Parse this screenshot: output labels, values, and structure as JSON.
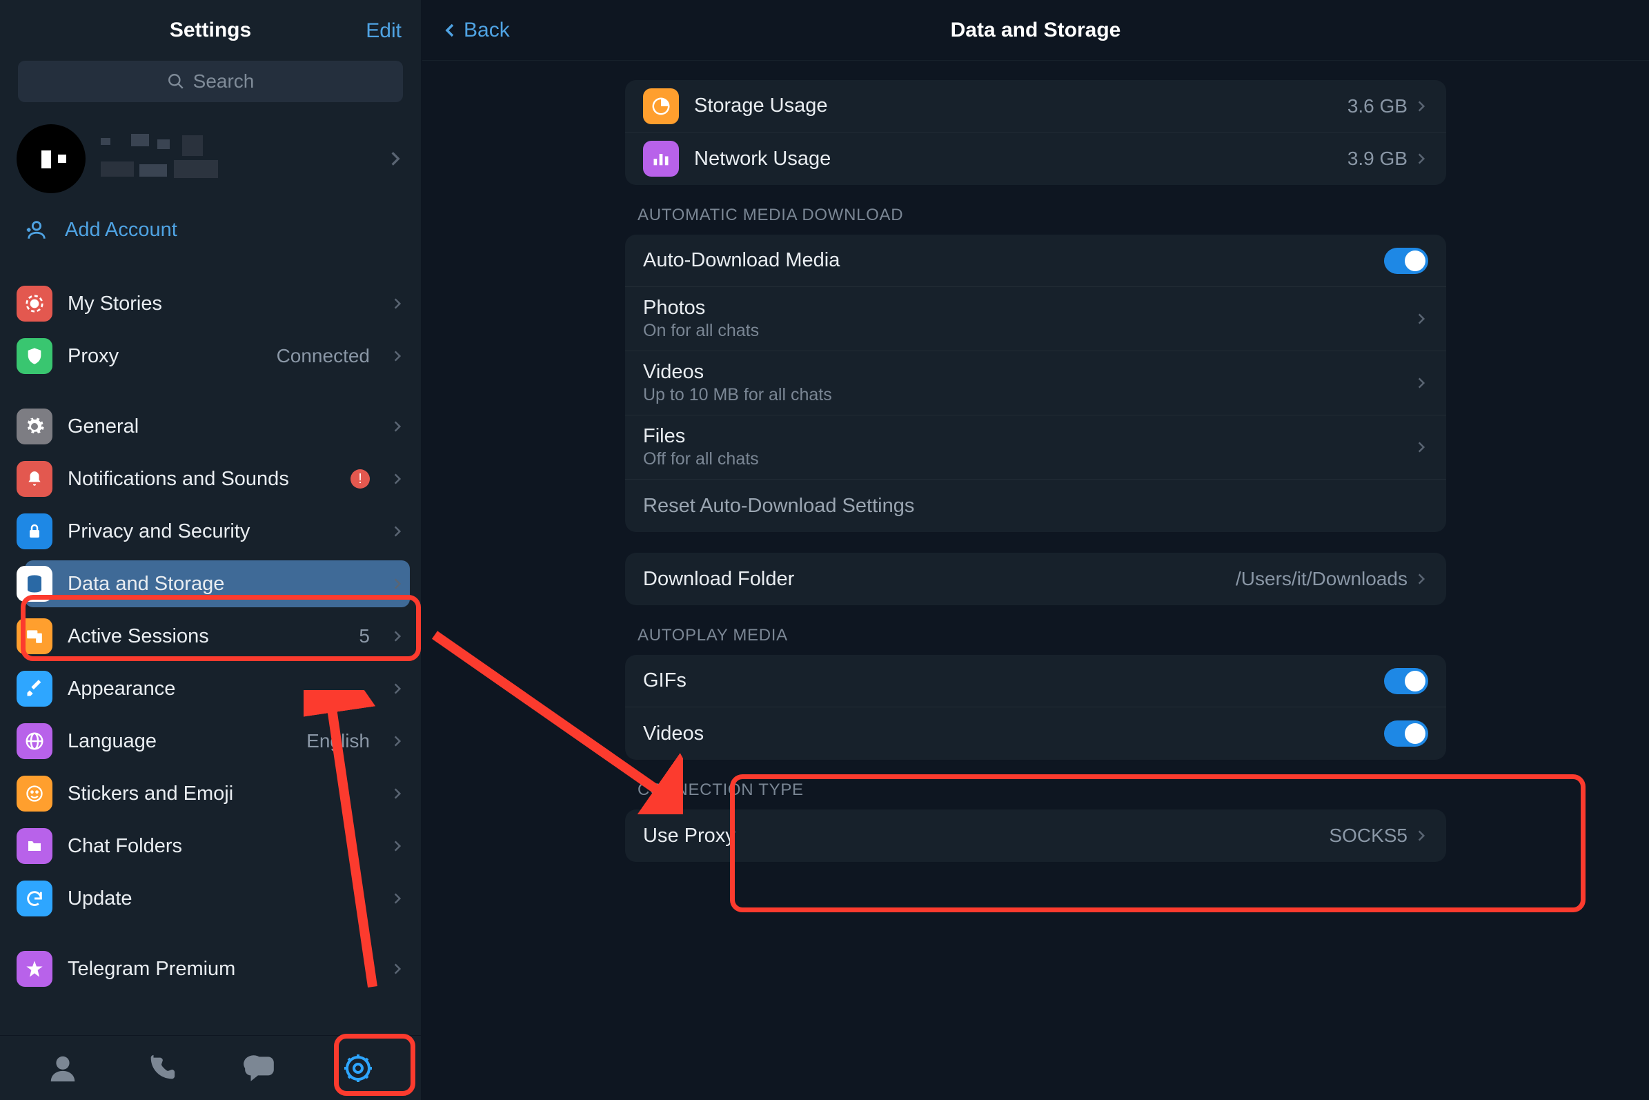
{
  "sidebar": {
    "title": "Settings",
    "edit": "Edit",
    "search_placeholder": "Search",
    "add_account": "Add Account",
    "items": [
      {
        "label": "My Stories",
        "icon": "stories",
        "color": "#e3584f"
      },
      {
        "label": "Proxy",
        "icon": "shield",
        "color": "#39c670",
        "value": "Connected"
      },
      {
        "label": "General",
        "icon": "gear",
        "color": "#7d7d83"
      },
      {
        "label": "Notifications and Sounds",
        "icon": "bell",
        "color": "#e3584f",
        "badge": "!"
      },
      {
        "label": "Privacy and Security",
        "icon": "lock",
        "color": "#1e88e5"
      },
      {
        "label": "Data and Storage",
        "icon": "database",
        "color": "#ffffff",
        "selected": true
      },
      {
        "label": "Active Sessions",
        "icon": "devices",
        "color": "#ff9f2e",
        "value": "5"
      },
      {
        "label": "Appearance",
        "icon": "brush",
        "color": "#2ea6ff"
      },
      {
        "label": "Language",
        "icon": "globe",
        "color": "#b862ea",
        "value": "English"
      },
      {
        "label": "Stickers and Emoji",
        "icon": "sticker",
        "color": "#ff9f2e"
      },
      {
        "label": "Chat Folders",
        "icon": "folder",
        "color": "#b862ea"
      },
      {
        "label": "Update",
        "icon": "update",
        "color": "#2ea6ff"
      },
      {
        "label": "Telegram Premium",
        "icon": "star",
        "color": "#b862ea"
      }
    ]
  },
  "main": {
    "back": "Back",
    "title": "Data and Storage",
    "usage": {
      "storage_label": "Storage Usage",
      "storage_value": "3.6 GB",
      "network_label": "Network Usage",
      "network_value": "3.9 GB"
    },
    "amd_title": "AUTOMATIC MEDIA DOWNLOAD",
    "amd": {
      "auto_label": "Auto-Download Media",
      "photos_label": "Photos",
      "photos_sub": "On for all chats",
      "videos_label": "Videos",
      "videos_sub": "Up to 10 MB for all chats",
      "files_label": "Files",
      "files_sub": "Off for all chats",
      "reset_label": "Reset Auto-Download Settings"
    },
    "download_folder_label": "Download Folder",
    "download_folder_value": "/Users/it/Downloads",
    "autoplay_title": "AUTOPLAY MEDIA",
    "autoplay": {
      "gifs": "GIFs",
      "videos": "Videos"
    },
    "conn_title": "CONNECTION TYPE",
    "conn": {
      "label": "Use Proxy",
      "value": "SOCKS5"
    }
  }
}
